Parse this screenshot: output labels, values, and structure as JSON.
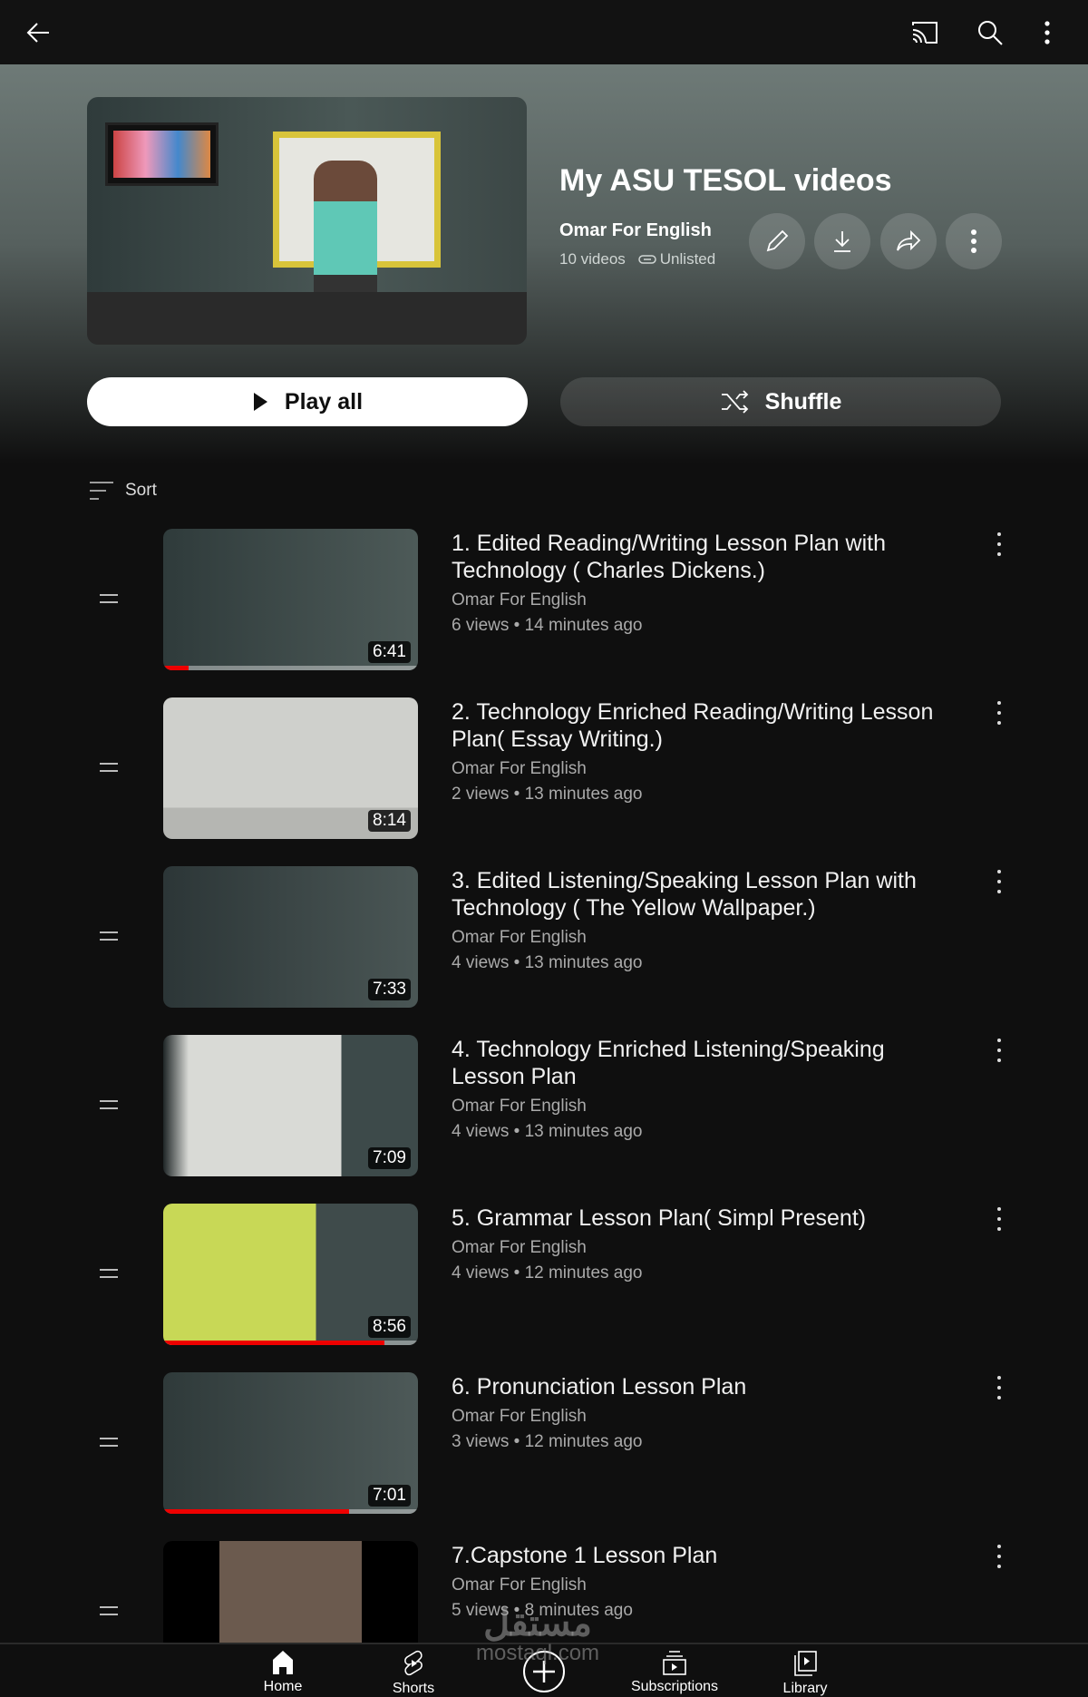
{
  "topbar": {
    "icons": [
      "back-arrow-icon",
      "cast-icon",
      "search-icon",
      "more-vert-icon"
    ]
  },
  "playlist": {
    "title": "My ASU TESOL videos",
    "channel": "Omar For English",
    "video_count": "10 videos",
    "privacy": "Unlisted"
  },
  "actions": {
    "play_all": "Play all",
    "shuffle": "Shuffle"
  },
  "sort_label": "Sort",
  "videos": [
    {
      "title": "1. Edited Reading/Writing Lesson Plan with Technology ( Charles Dickens.)",
      "channel": "Omar For English",
      "stats": "6 views • 14 minutes ago",
      "duration": "6:41",
      "progress": 10
    },
    {
      "title": "2. Technology Enriched Reading/Writing Lesson Plan( Essay Writing.)",
      "channel": "Omar For English",
      "stats": "2 views • 13 minutes ago",
      "duration": "8:14",
      "progress": 0
    },
    {
      "title": "3. Edited Listening/Speaking Lesson Plan with Technology ( The Yellow Wallpaper.)",
      "channel": "Omar For English",
      "stats": "4 views • 13 minutes ago",
      "duration": "7:33",
      "progress": 0
    },
    {
      "title": "4. Technology Enriched Listening/Speaking Lesson Plan",
      "channel": "Omar For English",
      "stats": "4 views • 13 minutes ago",
      "duration": "7:09",
      "progress": 0
    },
    {
      "title": "5. Grammar Lesson Plan( Simpl Present)",
      "channel": "Omar For English",
      "stats": "4 views • 12 minutes ago",
      "duration": "8:56",
      "progress": 87
    },
    {
      "title": "6. Pronunciation Lesson Plan",
      "channel": "Omar For English",
      "stats": "3 views • 12 minutes ago",
      "duration": "7:01",
      "progress": 73
    },
    {
      "title": "7.Capstone 1 Lesson Plan",
      "channel": "Omar For English",
      "stats": "5 views • 8 minutes ago",
      "duration": "",
      "progress": 0
    }
  ],
  "nav": [
    {
      "label": "Home"
    },
    {
      "label": "Shorts"
    },
    {
      "label": ""
    },
    {
      "label": "Subscriptions"
    },
    {
      "label": "Library"
    }
  ],
  "watermark": {
    "arabic": "مستقل",
    "latin": "mostaql.com"
  },
  "colors": {
    "accent": "#ff0000",
    "background": "#0f0f0f"
  }
}
